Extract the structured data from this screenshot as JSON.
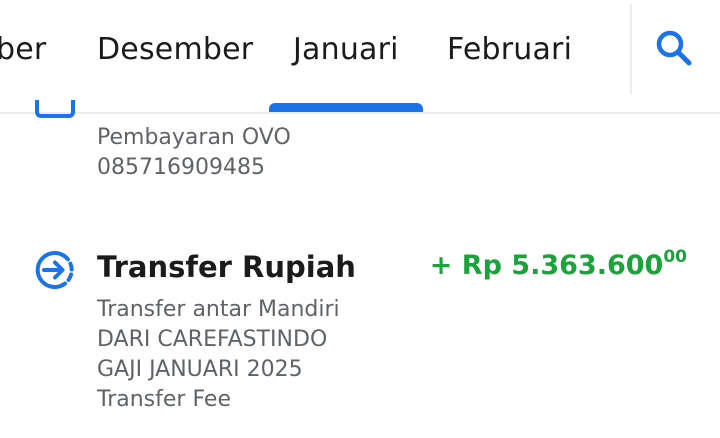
{
  "tabs": {
    "prev_partial": "ber",
    "items": [
      "Desember",
      "Januari",
      "Februari"
    ],
    "selected": "Januari"
  },
  "accent_color": "#1a73e8",
  "amount_color": "#1aa33a",
  "transactions": [
    {
      "details": [
        "Pembayaran OVO",
        "085716909485"
      ]
    },
    {
      "icon": "transfer-in-icon",
      "title": "Transfer Rupiah",
      "amount_main": "+ Rp 5.363.600",
      "amount_cents": "00",
      "details": [
        "Transfer antar Mandiri",
        "DARI CAREFASTINDO",
        "GAJI JANUARI 2025",
        "Transfer Fee"
      ]
    }
  ]
}
